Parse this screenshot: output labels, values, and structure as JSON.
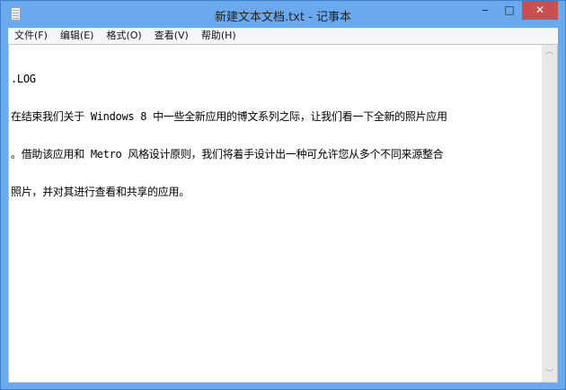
{
  "window": {
    "title": "新建文本文档.txt - 记事本",
    "minimize": "‒",
    "maximize": "□",
    "close": "✕"
  },
  "menu": [
    {
      "label": "文件(F)"
    },
    {
      "label": "编辑(E)"
    },
    {
      "label": "格式(O)"
    },
    {
      "label": "查看(V)"
    },
    {
      "label": "帮助(H)"
    }
  ],
  "document": {
    "lines": [
      ".LOG",
      "在结束我们关于 Windows 8 中一些全新应用的博文系列之际，让我们看一下全新的照片应用",
      "。借助该应用和 Metro 风格设计原则，我们将着手设计出一种可允许您从多个不同来源整合",
      "照片，并对其进行查看和共享的应用。"
    ]
  },
  "scrollbar": {
    "up": "︿",
    "down": "﹀"
  }
}
